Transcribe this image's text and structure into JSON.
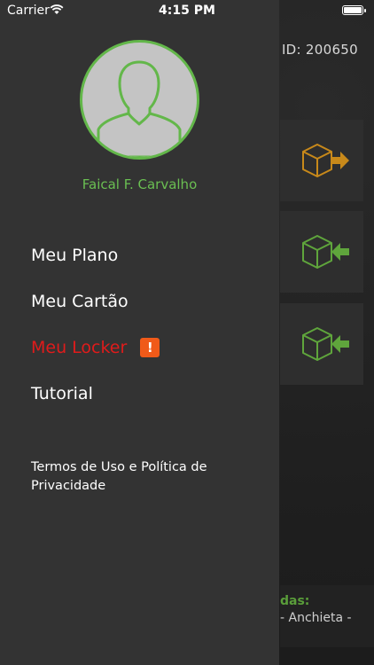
{
  "status_bar": {
    "carrier": "Carrier",
    "time": "4:15 PM"
  },
  "background": {
    "id_label": "ID: 200650",
    "bottom_label": "das:",
    "bottom_text": "- Anchieta -",
    "card_icon_colors": [
      "#c8891a",
      "#5fa53c",
      "#5fa53c"
    ]
  },
  "drawer": {
    "user_name": "Faical F. Carvalho",
    "menu": [
      {
        "label": "Meu Plano"
      },
      {
        "label": "Meu Cartão"
      },
      {
        "label": "Meu Locker",
        "badge": "!"
      },
      {
        "label": "Tutorial"
      }
    ],
    "terms_label": "Termos de Uso e Política de Privacidade"
  },
  "colors": {
    "accent_green": "#6abf52",
    "alert_red": "#e01b1b",
    "badge_orange": "#f05a19",
    "drawer_bg": "#333333"
  }
}
